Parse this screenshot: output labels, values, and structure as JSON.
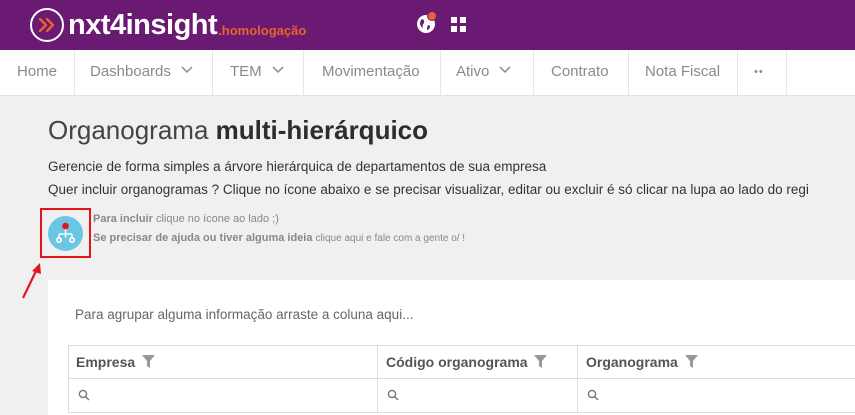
{
  "header": {
    "brand": "nxt4insight",
    "brand_suffix": ".homologação",
    "brand_color": "#6b1a73",
    "accent_color": "#e8622c",
    "icons": [
      "chevron-double-right-icon",
      "globe-icon",
      "apps-grid-icon"
    ]
  },
  "nav": {
    "items": [
      {
        "label": "Home"
      },
      {
        "label": "Dashboards"
      },
      {
        "label": "TEM"
      },
      {
        "label": "Movimentação"
      },
      {
        "label": "Ativo"
      },
      {
        "label": "Contrato"
      },
      {
        "label": "Nota Fiscal"
      },
      {
        "label": "••"
      }
    ]
  },
  "page": {
    "title_light": "Organograma",
    "title_bold": "multi-hierárquico",
    "desc1": "Gerencie de forma simples a árvore hierárquica de departamentos de sua empresa",
    "desc2": "Quer incluir organogramas ? Clique no ícone abaixo e se precisar visualizar, editar ou excluir é só clicar na lupa ao lado do regi",
    "hint1_bold": "Para incluir",
    "hint1_rest": "clique no ícone ao lado ;)",
    "hint2_bold": "Se precisar de ajuda ou tiver alguma ideia",
    "hint2_rest": "clique aqui e fale com a gente o/ !"
  },
  "grid": {
    "group_hint": "Para agrupar alguma informação arraste a coluna aqui...",
    "columns": [
      {
        "label": "Empresa"
      },
      {
        "label": "Código organograma"
      },
      {
        "label": "Organograma"
      }
    ]
  }
}
